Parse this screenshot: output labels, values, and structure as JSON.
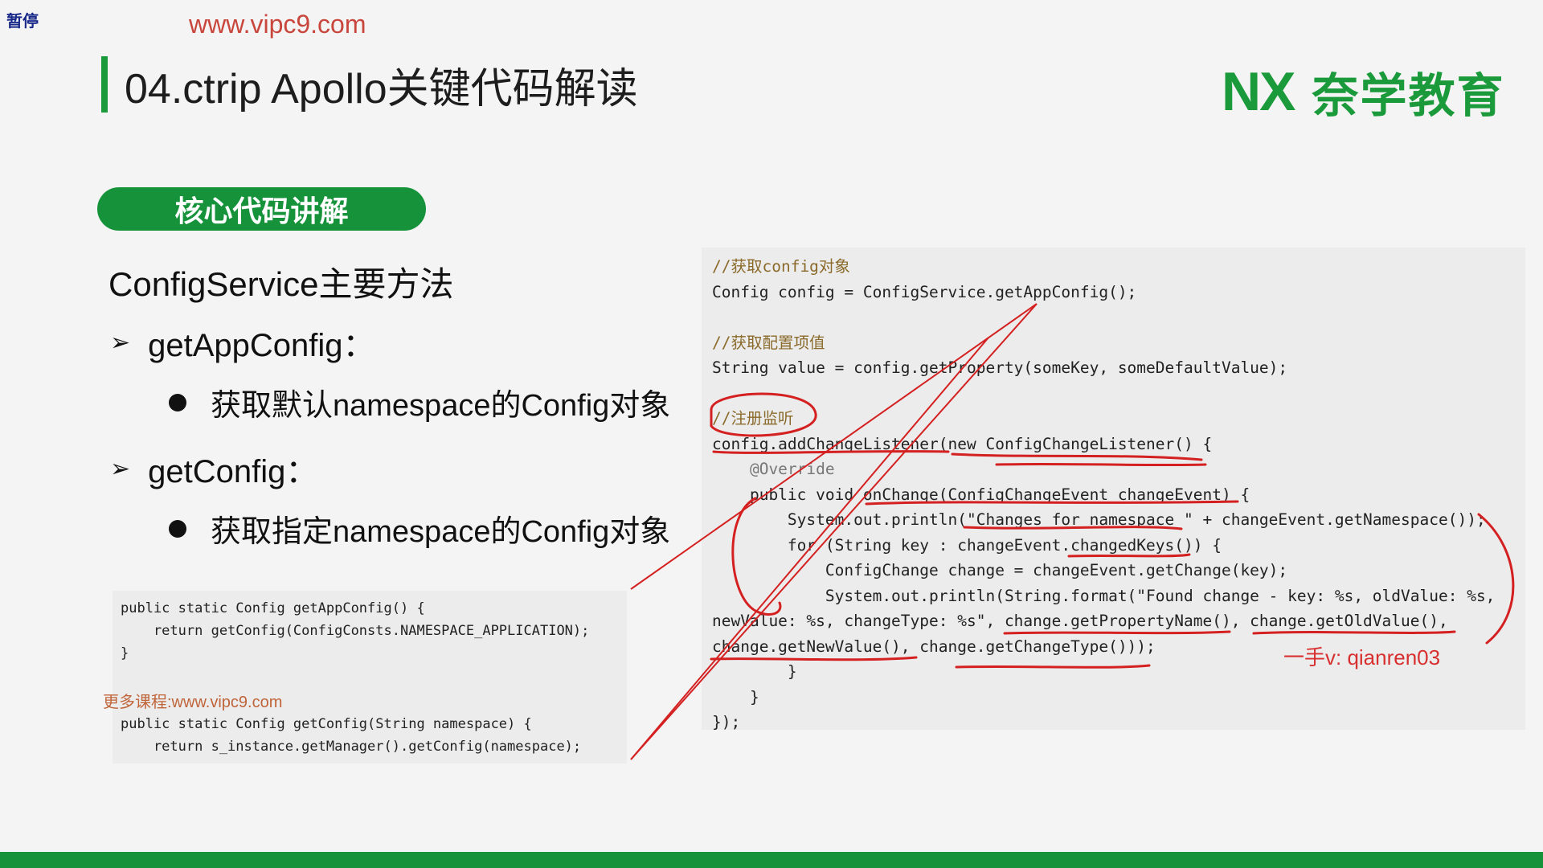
{
  "overlay": {
    "pause_label": "暂停",
    "watermark_url": "www.vipc9.com"
  },
  "slide": {
    "title": "04.ctrip Apollo关键代码解读",
    "section_label": "核心代码讲解"
  },
  "brand": {
    "logo_mark": "NX",
    "name": "奈学教育",
    "color": "#1a9a3a"
  },
  "content": {
    "heading": "ConfigService主要方法",
    "methods": [
      {
        "name": "getAppConfig：",
        "desc": "获取默认namespace的Config对象"
      },
      {
        "name": "getConfig：",
        "desc": "获取指定namespace的Config对象"
      }
    ]
  },
  "small_code": {
    "lines": [
      "public static Config getAppConfig() {",
      "    return getConfig(ConfigConsts.NAMESPACE_APPLICATION);",
      "}",
      "public static Config getConfig(String namespace) {",
      "    return s_instance.getManager().getConfig(namespace);"
    ]
  },
  "more_courses": "更多课程:www.vipc9.com",
  "big_code": {
    "lines": [
      "//获取config对象",
      "Config config = ConfigService.getAppConfig();",
      "",
      "//获取配置项值",
      "String value = config.getProperty(someKey, someDefaultValue);",
      "",
      "//注册监听",
      "config.addChangeListener(new ConfigChangeListener() {",
      "    @Override",
      "    public void onChange(ConfigChangeEvent changeEvent) {",
      "        System.out.println(\"Changes for namespace \" + changeEvent.getNamespace());",
      "        for (String key : changeEvent.changedKeys()) {",
      "            ConfigChange change = changeEvent.getChange(key);",
      "            System.out.println(String.format(\"Found change - key: %s, oldValue: %s,",
      "newValue: %s, changeType: %s\", change.getPropertyName(), change.getOldValue(),",
      "change.getNewValue(), change.getChangeType()));",
      "        }",
      "    }",
      "});"
    ]
  },
  "contact": "一手v: qianren03",
  "colors": {
    "accent_green": "#16933a",
    "annotation_red": "#d42020",
    "watermark": "#c8463c"
  }
}
